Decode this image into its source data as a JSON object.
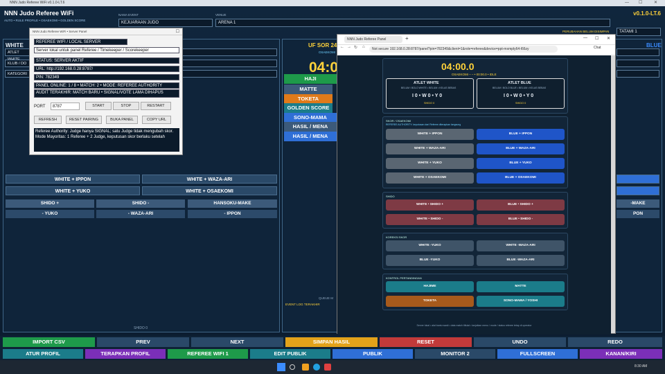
{
  "titlebar": {
    "title": "NNN Judo Referee WiFi v0.1.0-LT.6",
    "minimize": "—",
    "maximize": "☐",
    "close": "✕"
  },
  "header": {
    "title": "NNN Judo Referee WiFi",
    "subtitle": "AUTO • RULE PROFILE • OSAEKOMI • GOLDEN SCORE",
    "event_label": "NAMA EVENT",
    "event_value": "KEJUARAAN JUDO",
    "venue_label": "VENUE",
    "venue_value": "ARENA 1",
    "version": "v0.1.0-LT.6",
    "unsaved": "PERUBAHAN BELUM DISIMPAN",
    "tatami": "TATAMI 1"
  },
  "left": {
    "white": "WHITE",
    "atlet": "ATLET WHITE",
    "klub": "KLUB / DO",
    "kategori": "KATEGORI",
    "shido_footer": "SHIDO 0"
  },
  "center": {
    "match": "UF SOR 24",
    "osaekomi": "OSAEKOMI",
    "timer": "04:00",
    "hajime": "HAJI",
    "matte": "MATTE",
    "toketa": "TOKETA",
    "golden": "GOLDEN SCORE",
    "sono": "SONO-MAMA",
    "hasil1": "HASIL / MENA",
    "hasil2": "HASIL / MENA",
    "queue": "QUEUE M",
    "eventlog": "EVENT LOG TERAKHIR"
  },
  "right": {
    "blue": "BLUE",
    "make": "-MAKE",
    "pon": "PON"
  },
  "score_buttons": {
    "w_ippon": "WHITE + IPPON",
    "w_wazaari": "WHITE + WAZA-ARI",
    "w_yuko": "WHITE + YUKO",
    "w_osaekomi": "WHITE + OSAEKOMI",
    "shido_plus": "SHIDO +",
    "shido_minus": "SHIDO -",
    "hansoku": "HANSOKU-MAKE",
    "m_yuko": "- YUKO",
    "m_wazaari": "- WAZA-ARI",
    "m_ippon": "- IPPON"
  },
  "server": {
    "title": "NNN Judo Referee WiFi • Server Panel",
    "head": "REFEREE WIFI / LOCAL SERVER",
    "desc": "Server lokal untuk panel Referee / Timekeeper / Scorekeeper",
    "status": "STATUS: SERVER AKTIF",
    "url": "URL: http://192.168.0.28:8787/",
    "pin": "PIN: 782349",
    "online": "PANEL ONLINE: 1 / 8   •   MATCH: 2   •   MODE: REFEREE AUTHORITY",
    "audit": "AUDIT TERAKHIR: MATCH BARU • SIGNAL/VOTE LAMA DIHAPUS",
    "port_label": "PORT",
    "port_value": "8787",
    "start": "START",
    "stop": "STOP",
    "restart": "RESTART",
    "refresh": "REFRESH",
    "reset_pairing": "RESET PAIRING",
    "buka": "BUKA PANEL",
    "copy": "COPY URL",
    "note1": "Referee Authority: Judge hanya SIGNAL; satu Judge tidak mengubah skor.",
    "note2": "Mode Mayoritas: 1 Referee + 2 Judge, keputusan skor berlaku setelah"
  },
  "browser": {
    "tab": "NNN Judo Referee Panel",
    "address": "Not secure   192.168.0.28:8787/panel?pin=782349&client=1&role=referee&device=ppt-mxmply64-l66zy",
    "chat": "Chat",
    "timer": "04:00.0",
    "status": "OSAEKOMI – – • 00:00.0 • IDLE",
    "w_title": "ATLET WHITE",
    "w_meta": "BELUM / BOLO WHITE • BELUM • KELAS BEBAS",
    "w_score": "I 0 • W 0 • Y 0",
    "w_shido": "SHIDO 0",
    "b_title": "ATLET BLUE",
    "b_meta": "BELUM / BOLO BLUE • BELUM • KELAS BEBAS",
    "b_score": "I 0 • W 0 • Y 0",
    "b_shido": "SHIDO 0",
    "skor_title": "SKOR / OSAEKOMI",
    "skor_sub": "REFEREE AUTHORITY: keputusan dari Referee diterapkan langsung",
    "r_w_ippon": "WHITE + IPPON",
    "r_b_ippon": "BLUE + IPPON",
    "r_w_waza": "WHITE + WAZA-ARI",
    "r_b_waza": "BLUE + WAZA-ARI",
    "r_w_yuko": "WHITE + YUKO",
    "r_b_yuko": "BLUE + YUKO",
    "r_w_osae": "WHITE + OSAEKOMI",
    "r_b_osae": "BLUE + OSAEKOMI",
    "shido_title": "SHIDO",
    "r_w_sp": "WHITE • SHIDO +",
    "r_b_sp": "BLUE • SHIDO +",
    "r_w_sm": "WHITE • SHIDO -",
    "r_b_sm": "BLUE • SHIDO -",
    "koreksi_title": "KOREKSI SKOR",
    "r_w_my": "WHITE -YUKO",
    "r_w_mw": "WHITE -WAZA-ARI",
    "r_b_my": "BLUE -YUKO",
    "r_b_mw": "BLUE -WAZA-ARI",
    "kontrol_title": "KONTROL PERTANDINGAN",
    "hajime": "HAJIME",
    "matte": "MATTE",
    "toketa": "TOKETA",
    "sono": "SONO-MAMA / YOSHI",
    "footer": "Server lokal • alat bantu wasit • data match tiltulat • lanjutkan menu / mode / status referee tetap di operator"
  },
  "bottom1": {
    "import": "IMPORT CSV",
    "prev": "PREV",
    "next": "NEXT",
    "simpan": "SIMPAN HASIL",
    "reset": "RESET",
    "undo": "UNDO",
    "redo": "REDO"
  },
  "bottom2": {
    "atur": "ATUR PROFIL",
    "terapkan": "TERAPKAN PROFIL",
    "wifi": "REFEREE WIFI 1",
    "edit": "EDIT PUBLIK",
    "publik": "PUBLIK",
    "monitor": "MONITOR 2",
    "full": "FULLSCREEN",
    "kanan": "KANAN/KIRI"
  },
  "colors": {
    "accent_yellow": "#ffd23a",
    "white_btn": "#3c5a7a",
    "blue_btn": "#2f6fd6",
    "green": "#1e9a4a",
    "purple": "#7b2fb8",
    "orange": "#e2a21a",
    "red": "#c23a3a"
  },
  "taskbar": {
    "search": "Search",
    "clock": "8:30 AM"
  }
}
